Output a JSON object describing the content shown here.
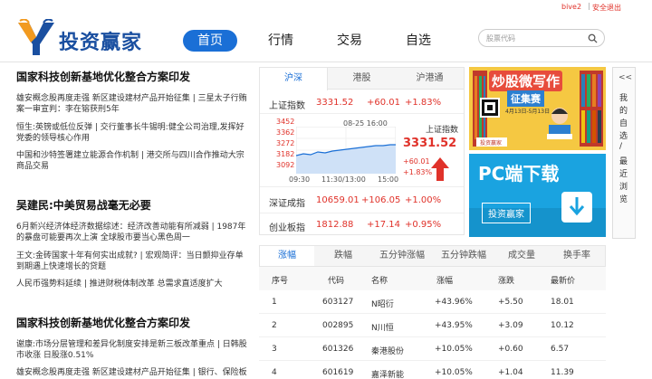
{
  "topbar": {
    "user": "bive2",
    "separator": "|",
    "logout": "安全退出"
  },
  "logo": {
    "name": "投资赢家"
  },
  "nav": [
    {
      "label": "首页",
      "active": true
    },
    {
      "label": "行情"
    },
    {
      "label": "交易"
    },
    {
      "label": "自选"
    }
  ],
  "search": {
    "placeholder": "股票代码"
  },
  "news": {
    "sections": [
      {
        "headline": "国家科技创新基地优化整合方案印发",
        "lines": [
          "雄安概念股再度走强 新区建设建材产品开始征集 | 三星太子行贿",
          "案一审宣判：李在镕获刑5年",
          "恒生:英镑或低位反弹 | 交行董事长牛锡明:健全公司治理,发挥好",
          "党委的领导核心作用",
          "中国和沙特签署建立能源合作机制 | 港交所与四川合作推动大宗",
          "商品交易"
        ]
      },
      {
        "headline": "吴建民:中美贸易战毫无必要",
        "lines": [
          "6月新兴经济体经济数据综述：经济改善动能有所减弱 | 1987年",
          "的暴盘可能要再次上演 全球股市要当心黑色周一",
          "王文:金砖国家十年有何实出成就? | 宏观简评：当日颤抑业存单",
          "到期遇上快速增长的贷题",
          "人民币强势料延续 | 推进财税体制改革 总需求直适度扩大"
        ]
      },
      {
        "headline": "国家科技创新基地优化整合方案印发",
        "lines": [
          "谢康:市场分层管理和差异化制度安排是新三板改革重点 | 日韩股",
          "市收涨 日股涨0.51%",
          "雄安概念股再度走强 新区建设建材产品开始征集 | 银行、保险板"
        ]
      }
    ]
  },
  "market": {
    "tabs": [
      {
        "label": "沪深",
        "active": true
      },
      {
        "label": "港股"
      },
      {
        "label": "沪港通"
      }
    ],
    "indices": [
      {
        "name": "上证指数",
        "value": "3331.52",
        "change": "+60.01",
        "pct": "+1.83%"
      },
      {
        "name": "深证成指",
        "value": "10659.01",
        "change": "+106.05",
        "pct": "+1.00%"
      },
      {
        "name": "创业板指",
        "value": "1812.88",
        "change": "+17.14",
        "pct": "+0.95%"
      }
    ],
    "chart": {
      "date": "08-25 16:00",
      "ylabels": [
        "3452",
        "3362",
        "3272",
        "3182",
        "3092"
      ],
      "xlabels": [
        "09:30",
        "11:30/13:00",
        "15:00"
      ],
      "index_name": "上证指数",
      "index_value": "3331.52",
      "index_change": "+60.01",
      "index_pct": "+1.83%",
      "accent": "#e0322a"
    }
  },
  "ads": {
    "ad1": {
      "title": "炒股微写作",
      "subtitle": "征集赛",
      "dates": "4月13日-5月13日",
      "brand": "投资赢家"
    },
    "ad2": {
      "title": "PC端下载",
      "button": "投资赢家"
    }
  },
  "side": {
    "arrow": "<<",
    "chars": [
      "我",
      "的",
      "自",
      "选",
      "/",
      "最",
      "近",
      "浏",
      "览"
    ]
  },
  "table": {
    "tabs": [
      {
        "label": "涨幅",
        "active": true
      },
      {
        "label": "跌幅"
      },
      {
        "label": "五分钟涨幅"
      },
      {
        "label": "五分钟跌幅"
      },
      {
        "label": "成交量"
      },
      {
        "label": "换手率"
      }
    ],
    "headers": [
      "序号",
      "代码",
      "名称",
      "涨幅",
      "涨跌",
      "最新价"
    ],
    "rows": [
      [
        "1",
        "603127",
        "N昭衍",
        "+43.96%",
        "+5.50",
        "18.01"
      ],
      [
        "2",
        "002895",
        "N川恒",
        "+43.95%",
        "+3.09",
        "10.12"
      ],
      [
        "3",
        "601326",
        "秦港股份",
        "+10.05%",
        "+0.60",
        "6.57"
      ],
      [
        "4",
        "601619",
        "嘉泽新能",
        "+10.05%",
        "+1.04",
        "11.39"
      ]
    ]
  }
}
